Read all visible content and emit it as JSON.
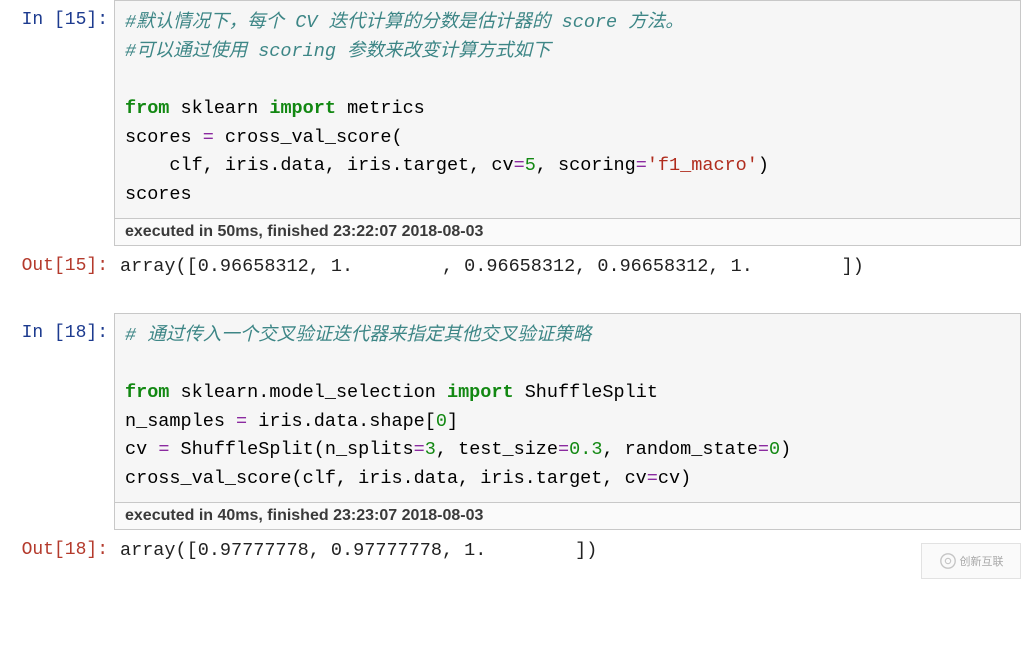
{
  "cells": [
    {
      "in_label": "In  [15]:",
      "code": {
        "line1_comment": "#默认情况下，每个 CV 迭代计算的分数是估计器的 score 方法。",
        "line2_comment": "#可以通过使用 scoring 参数来改变计算方式如下",
        "line3_from": "from",
        "line3_mod": " sklearn ",
        "line3_import": "import",
        "line3_tail": " metrics",
        "line4_lhs": "scores ",
        "line4_eq": "=",
        "line4_rhs": " cross_val_score(",
        "line5_indent": "    clf, iris.data, iris.target, cv",
        "line5_eq1": "=",
        "line5_num": "5",
        "line5_mid": ", scoring",
        "line5_eq2": "=",
        "line5_str": "'f1_macro'",
        "line5_end": ")",
        "line6": "scores"
      },
      "exec": "executed in 50ms, finished 23:22:07 2018-08-03",
      "out_label": "Out[15]:",
      "output": "array([0.96658312, 1.        , 0.96658312, 0.96658312, 1.        ])"
    },
    {
      "in_label": "In  [18]:",
      "code": {
        "line1_comment": "# 通过传入一个交叉验证迭代器来指定其他交叉验证策略",
        "line2_from": "from",
        "line2_mod": " sklearn.model_selection ",
        "line2_import": "import",
        "line2_tail": " ShuffleSplit",
        "line3_lhs": "n_samples ",
        "line3_eq": "=",
        "line3_mid": " iris.data.shape[",
        "line3_num": "0",
        "line3_end": "]",
        "line4_lhs": "cv ",
        "line4_eq": "=",
        "line4_mid1": " ShuffleSplit(n_splits",
        "line4_eq1": "=",
        "line4_num1": "3",
        "line4_mid2": ", test_size",
        "line4_eq2": "=",
        "line4_num2": "0.3",
        "line4_mid3": ", random_state",
        "line4_eq3": "=",
        "line4_num3": "0",
        "line4_end": ")",
        "line5_a": "cross_val_score(clf, iris.data, iris.target, cv",
        "line5_eq": "=",
        "line5_b": "cv)"
      },
      "exec": "executed in 40ms, finished 23:23:07 2018-08-03",
      "out_label": "Out[18]:",
      "output": "array([0.97777778, 0.97777778, 1.        ])"
    }
  ],
  "watermark": "创新互联"
}
